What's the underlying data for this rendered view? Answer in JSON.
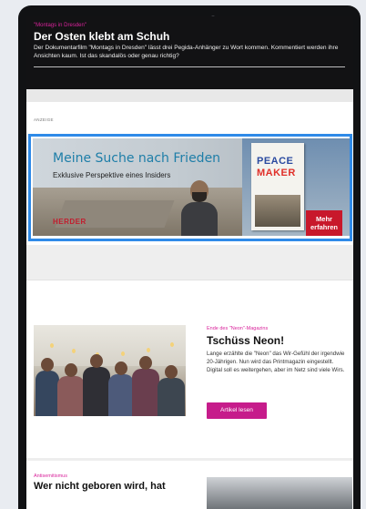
{
  "hero": {
    "kicker": "\"Montags in Dresden\"",
    "title": "Der Osten klebt am Schuh",
    "teaser": "Der Dokumentarfilm \"Montags in Dresden\" lässt drei Pegida-Anhänger zu Wort kommen. Kommentiert werden ihre Ansichten kaum. Ist das skandalös oder genau richtig?"
  },
  "ad": {
    "label": "ANZEIGE",
    "headline": "Meine Suche nach Frieden",
    "subline": "Exklusive Perspektive eines Insiders",
    "publisher": "HERDER",
    "book": {
      "title_line1": "PEACE",
      "title_line2": "MAKER"
    },
    "cta_line1": "Mehr",
    "cta_line2": "erfahren",
    "highlight_color": "#2f8ae8"
  },
  "article": {
    "kicker": "Ende des \"Neon\"-Magazins",
    "title": "Tschüss Neon!",
    "teaser": "Lange erzählte die \"Neon\" das Wir-Gefühl der irgendwie 20-Jährigen. Nun wird das Printmagazin eingestellt. Digital soll es weitergehen, aber im Netz sind viele Wirs.",
    "button_label": "Artikel lesen",
    "accent_color": "#c61c8b"
  },
  "next_article": {
    "kicker": "Antisemitismus",
    "title": "Wer nicht geboren wird, hat"
  }
}
